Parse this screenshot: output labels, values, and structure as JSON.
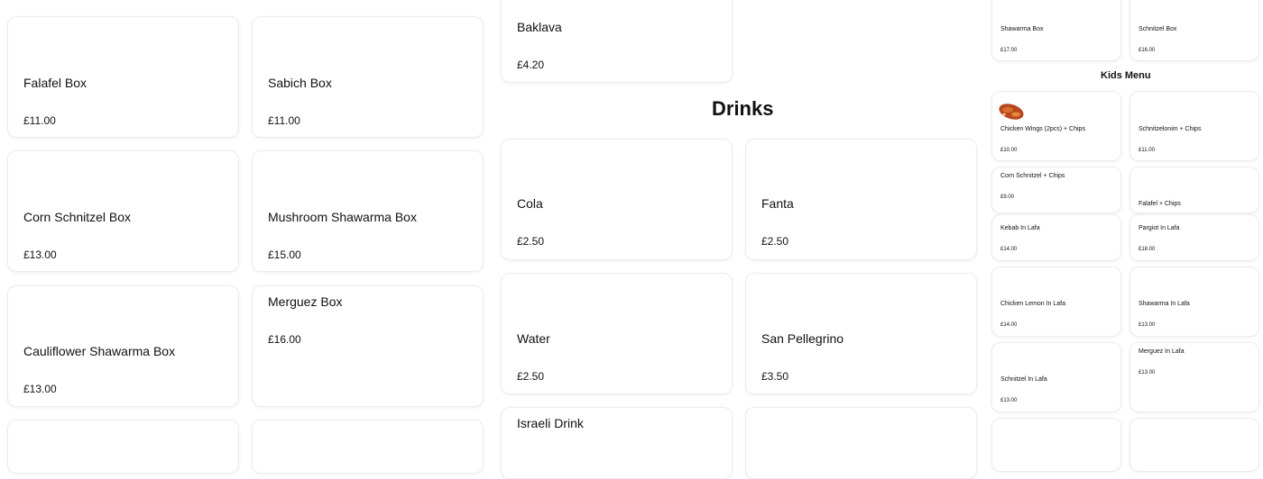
{
  "boxes": [
    {
      "name": "Falafel Box",
      "price": "£11.00"
    },
    {
      "name": "Sabich Box",
      "price": "£11.00"
    },
    {
      "name": "Corn Schnitzel Box",
      "price": "£13.00"
    },
    {
      "name": "Mushroom Shawarma Box",
      "price": "£15.00"
    },
    {
      "name": "Cauliflower Shawarma Box",
      "price": "£13.00"
    },
    {
      "name": "Merguez Box",
      "price": "£16.00"
    }
  ],
  "desserts": [
    {
      "name": "Baklava",
      "price": "£4.20"
    }
  ],
  "drinks": {
    "heading": "Drinks",
    "items": [
      {
        "name": "Cola",
        "price": "£2.50"
      },
      {
        "name": "Fanta",
        "price": "£2.50"
      },
      {
        "name": "Water",
        "price": "£2.50"
      },
      {
        "name": "San Pellegrino",
        "price": "£3.50"
      },
      {
        "name": "Israeli Drink",
        "price": ""
      }
    ]
  },
  "side_boxes": [
    {
      "name": "Shawarma Box",
      "price": "£17.00"
    },
    {
      "name": "Schnitzel Box",
      "price": "£16.00"
    }
  ],
  "kids_menu": {
    "heading": "Kids Menu",
    "items": [
      {
        "name": "Chicken Wings (2pcs) + Chips",
        "price": "£10.00",
        "icon": "chicken-wings-image"
      },
      {
        "name": "Schnitzelonim + Chips",
        "price": "£11.00"
      },
      {
        "name": "Corn Schnitzel + Chips",
        "price": "£9.00"
      },
      {
        "name": "Falafel + Chips",
        "price": ""
      }
    ]
  },
  "lafa": [
    {
      "name": "Kebab In Lafa",
      "price": "£14.00"
    },
    {
      "name": "Pargiot In Lafa",
      "price": "£18.00"
    },
    {
      "name": "Chicken Lemon In Lafa",
      "price": "£14.00"
    },
    {
      "name": "Shawarma In Lafa",
      "price": "£13.00"
    },
    {
      "name": "Schnitzel In Lafa",
      "price": "£13.00"
    },
    {
      "name": "Merguez In Lafa",
      "price": "£13.00"
    }
  ]
}
